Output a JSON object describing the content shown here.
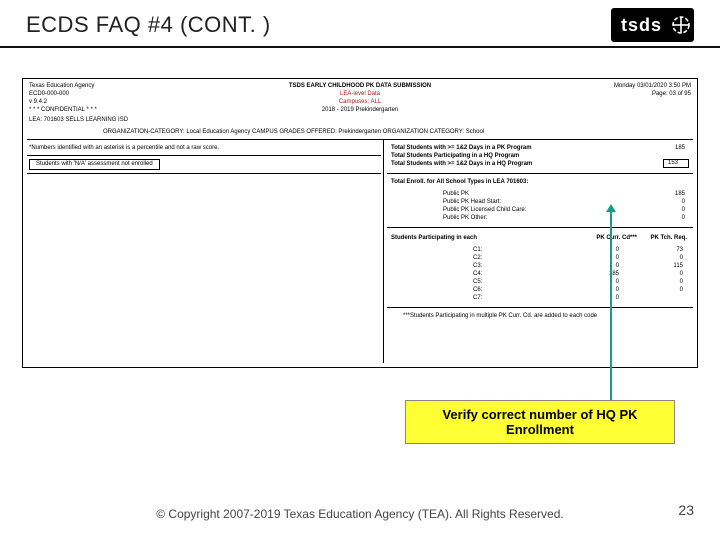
{
  "slide": {
    "title": "ECDS FAQ #4 (CONT. )",
    "logo_text": "tsds"
  },
  "report": {
    "agency": "Texas Education Agency",
    "id": "ECD0-000-000",
    "version": "v 9.4.2",
    "confidential": "* * * CONFIDENTIAL * * *",
    "lea_line": "LEA:    701603   SELLS LEARNING ISD",
    "title": "TSDS EARLY CHILDHOOD PK DATA SUBMISSION",
    "lea_level": "LEA-level Data",
    "campuses": "Campuses: ALL",
    "year": "2018 - 2019 Prekindergarten",
    "datetime": "Monday 03/01/2020 3:50 PM",
    "page": "Page: 03 of 95",
    "org_line": "ORGANIZATION-CATEGORY: Local Education Agency          CAMPUS GRADES OFFERED: Prekindergarten          ORGANIZATION CATEGORY: School",
    "note1": "*Numbers identified with an asterisk is a percentile and not a raw score.",
    "note2": "Students with 'N/A' assessment not enrolled",
    "totals": {
      "l1": "Total Students with >= 1&2 Days in a PK Program",
      "v1": "185",
      "l2": "Total Students Participating in a HQ Program",
      "l3": "Total Students with >= 1&2 Days in a HQ Program",
      "v3": "153"
    },
    "enroll": {
      "title": "Total Enroll. for All School Types in LEA 701603:",
      "rows": [
        {
          "l": "Public PK",
          "v": "185"
        },
        {
          "l": "Public PK Head Start:",
          "v": "0"
        },
        {
          "l": "Public PK Licensed Child Care:",
          "v": "0"
        },
        {
          "l": "Public PK Other:",
          "v": "0"
        }
      ]
    },
    "participating": {
      "title": "Students Participating in each",
      "col1": "PK Curr. Cd***",
      "col2": "PK Tch. Req.",
      "rows": [
        {
          "l": "C1:",
          "a": "0",
          "b": "73"
        },
        {
          "l": "C2:",
          "a": "0",
          "b": "0"
        },
        {
          "l": "C3:",
          "a": "0",
          "b": "115"
        },
        {
          "l": "C4:",
          "a": "185",
          "b": "0"
        },
        {
          "l": "C5:",
          "a": "0",
          "b": "0"
        },
        {
          "l": "C6:",
          "a": "0",
          "b": "0"
        },
        {
          "l": "C7:",
          "a": "0",
          "b": ""
        }
      ],
      "footnote": "***Students Participating in multiple PK Curr. Cd.  are added to each code"
    }
  },
  "callout": "Verify correct number of HQ PK Enrollment",
  "copyright": "© Copyright 2007-2019 Texas Education Agency (TEA). All Rights Reserved.",
  "page_number": "23"
}
